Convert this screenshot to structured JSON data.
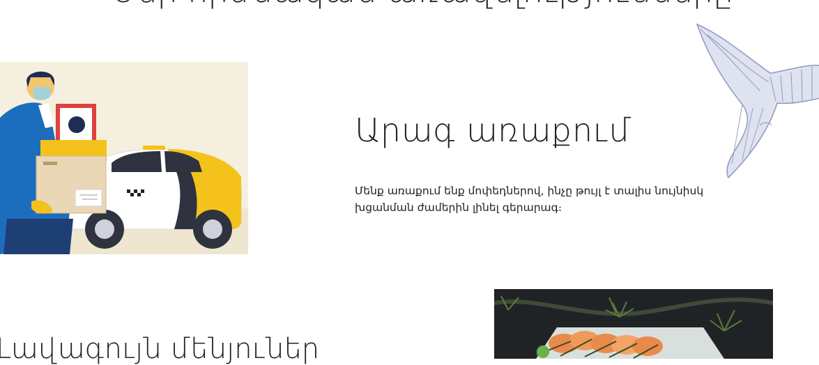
{
  "top_heading": "Մեր հիմնական առավելությունները",
  "delivery": {
    "title": "Արագ առաքում",
    "description": "Մենք առաքում ենք մոփեդներով, ինչը թույլ է տալիս նույնիսկ խցանման ժամերին լինել գերարագ։"
  },
  "next_section": {
    "title": "Լավագույն մենյուներ"
  }
}
